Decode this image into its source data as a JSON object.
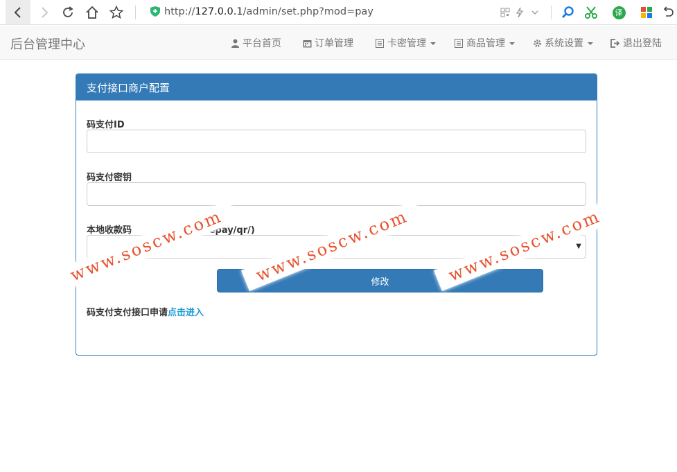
{
  "browser": {
    "url_prefix": "http://",
    "url_host": "127.0.0.1",
    "url_path": "/admin/set.php?mod=pay",
    "icons": [
      "back-icon",
      "forward-icon",
      "reload-icon",
      "home-icon",
      "star-icon",
      "shield-icon",
      "qr-icon",
      "lightning-icon",
      "search-icon",
      "scissors-icon",
      "translate-icon",
      "apps-icon",
      "undo-icon"
    ],
    "translate_label": "译"
  },
  "navbar": {
    "brand": "后台管理中心",
    "items": [
      {
        "label": "平台首页",
        "icon": "user-icon",
        "dropdown": false
      },
      {
        "label": "订单管理",
        "icon": "calendar-icon",
        "dropdown": false
      },
      {
        "label": "卡密管理",
        "icon": "list-icon",
        "dropdown": true
      },
      {
        "label": "商品管理",
        "icon": "list-icon",
        "dropdown": true
      },
      {
        "label": "系统设置",
        "icon": "gear-icon",
        "dropdown": true
      },
      {
        "label": "退出登陆",
        "icon": "logout-icon",
        "dropdown": false
      }
    ]
  },
  "panel": {
    "title": "支付接口商户配置",
    "fields": {
      "id_label": "码支付ID",
      "id_value": "",
      "key_label": "码支付密钥",
      "key_value": "",
      "qr_label": "本地收款码",
      "qr_label_suffix": "至/codepay/qr/)",
      "qr_selected": ""
    },
    "submit_label": "修改",
    "apply_text": "码支付支付接口申请",
    "apply_link": "点击进入"
  },
  "watermark": {
    "text": "www.soscw.com"
  },
  "colors": {
    "primary": "#337ab7",
    "link": "#1e9bd4",
    "watermark": "#e8512b",
    "navbar_bg": "#f8f8f8"
  }
}
